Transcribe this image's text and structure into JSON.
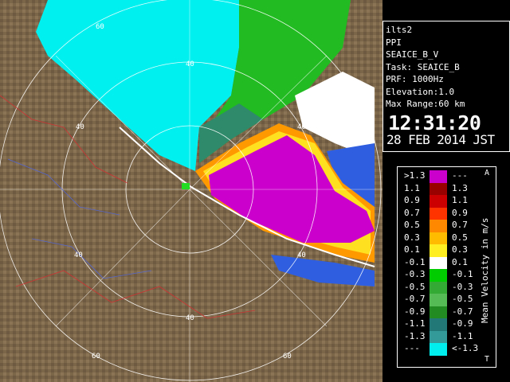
{
  "info_panel": {
    "lines": [
      "ilts2",
      "PPI",
      "SEAICE_B_V",
      "Task: SEAICE_B",
      "PRF: 1000Hz",
      "Elevation:1.0",
      "Max Range:60 km"
    ],
    "time": "12:31:20",
    "date": "28 FEB 2014 JST"
  },
  "legend": {
    "title": "Mean Velocity in m/s",
    "top_marker": "A",
    "bottom_marker": "T",
    "rows": [
      {
        "left": ">1.3",
        "right": "---",
        "color": "#cc00cc"
      },
      {
        "left": "1.1",
        "right": "1.3",
        "color": "#990000"
      },
      {
        "left": "0.9",
        "right": "1.1",
        "color": "#cc0000"
      },
      {
        "left": "0.7",
        "right": "0.9",
        "color": "#ff3300"
      },
      {
        "left": "0.5",
        "right": "0.7",
        "color": "#ff8800"
      },
      {
        "left": "0.3",
        "right": "0.5",
        "color": "#ffbb00"
      },
      {
        "left": "0.1",
        "right": "0.3",
        "color": "#ffee22"
      },
      {
        "left": "-0.1",
        "right": "0.1",
        "color": "#ffffff"
      },
      {
        "left": "-0.3",
        "right": "-0.1",
        "color": "#00cc00"
      },
      {
        "left": "-0.5",
        "right": "-0.3",
        "color": "#33aa33"
      },
      {
        "left": "-0.7",
        "right": "-0.5",
        "color": "#55bb55"
      },
      {
        "left": "-0.9",
        "right": "-0.7",
        "color": "#228b22"
      },
      {
        "left": "-1.1",
        "right": "-0.9",
        "color": "#227777"
      },
      {
        "left": "-1.3",
        "right": "-1.1",
        "color": "#339999"
      },
      {
        "left": "---",
        "right": "<-1.3",
        "color": "#00eeee"
      }
    ]
  },
  "map": {
    "range_labels": [
      "60",
      "40",
      "40",
      "40",
      "40",
      "40",
      "60",
      "40",
      "60"
    ],
    "colors": {
      "terrain": "#7a6548",
      "approaching_far": "#00eeee",
      "receding_strong": "#cc00cc",
      "near_zero": "#ffffff",
      "approaching_blue": "#3366dd",
      "green": "#22bb22"
    }
  }
}
